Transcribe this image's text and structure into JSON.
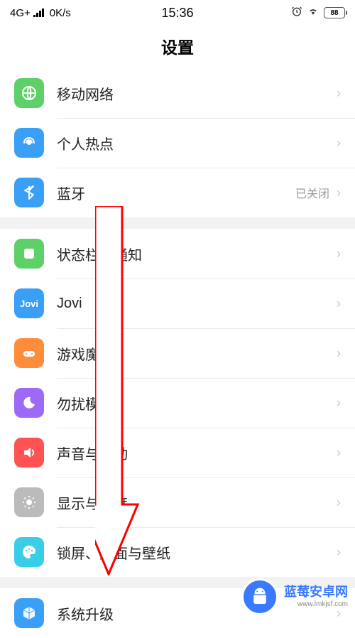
{
  "statusBar": {
    "network": "4G+",
    "speed": "0K/s",
    "time": "15:36",
    "battery": "88"
  },
  "pageTitle": "设置",
  "sections": [
    {
      "items": [
        {
          "label": "移动网络"
        },
        {
          "label": "个人热点"
        },
        {
          "label": "蓝牙",
          "extra": "已关闭"
        }
      ]
    },
    {
      "items": [
        {
          "label": "状态栏与通知"
        },
        {
          "label": "Jovi"
        },
        {
          "label": "游戏魔盒"
        },
        {
          "label": "勿扰模式"
        },
        {
          "label": "声音与振动"
        },
        {
          "label": "显示与亮度"
        },
        {
          "label": "锁屏、桌面与壁纸"
        }
      ]
    },
    {
      "items": [
        {
          "label": "系统升级"
        }
      ]
    }
  ],
  "watermark": {
    "title": "蓝莓安卓网",
    "url": "www.lmkjsf.com"
  }
}
